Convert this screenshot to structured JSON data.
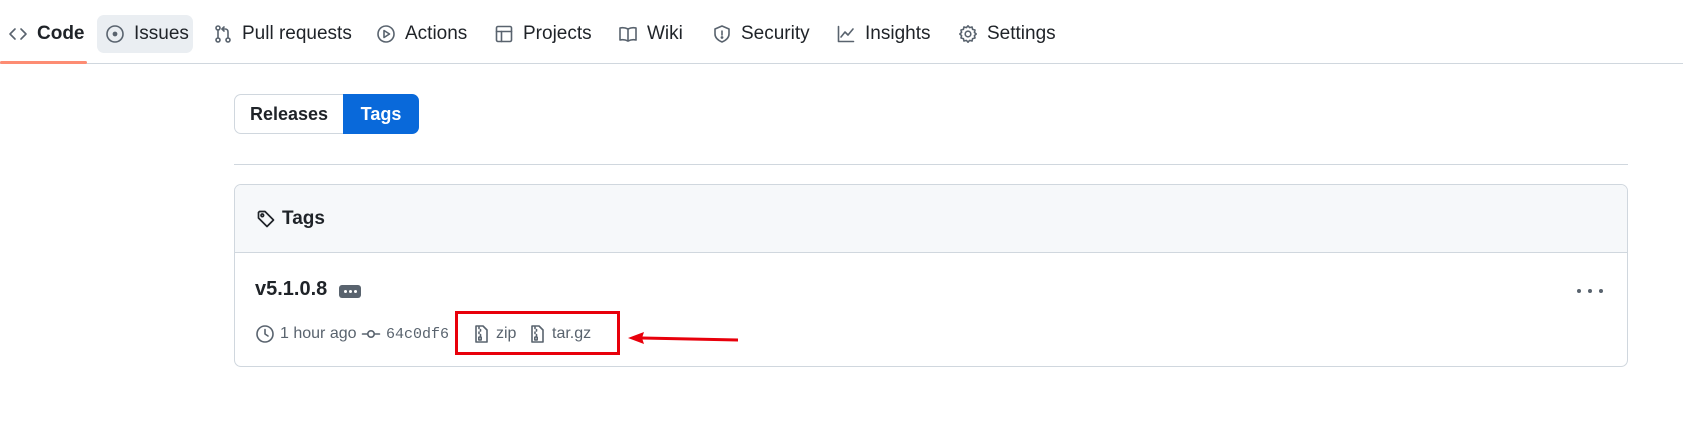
{
  "nav": {
    "items": [
      {
        "label": "Code",
        "icon": "code-icon"
      },
      {
        "label": "Issues",
        "icon": "issue-opened-icon"
      },
      {
        "label": "Pull requests",
        "icon": "git-pull-request-icon"
      },
      {
        "label": "Actions",
        "icon": "play-icon"
      },
      {
        "label": "Projects",
        "icon": "table-icon"
      },
      {
        "label": "Wiki",
        "icon": "book-icon"
      },
      {
        "label": "Security",
        "icon": "shield-icon"
      },
      {
        "label": "Insights",
        "icon": "graph-icon"
      },
      {
        "label": "Settings",
        "icon": "gear-icon"
      }
    ],
    "selected": "Code",
    "accent_color": "#fd8c73"
  },
  "toggle": {
    "releases_label": "Releases",
    "tags_label": "Tags",
    "active": "Tags",
    "active_color": "#0969da"
  },
  "tags_box": {
    "header": "Tags",
    "tag": {
      "name": "v5.1.0.8",
      "time": "1 hour ago",
      "commit": "64c0df6",
      "zip_label": "zip",
      "targz_label": "tar.gz"
    }
  },
  "annotation": {
    "color": "#e8000b"
  }
}
